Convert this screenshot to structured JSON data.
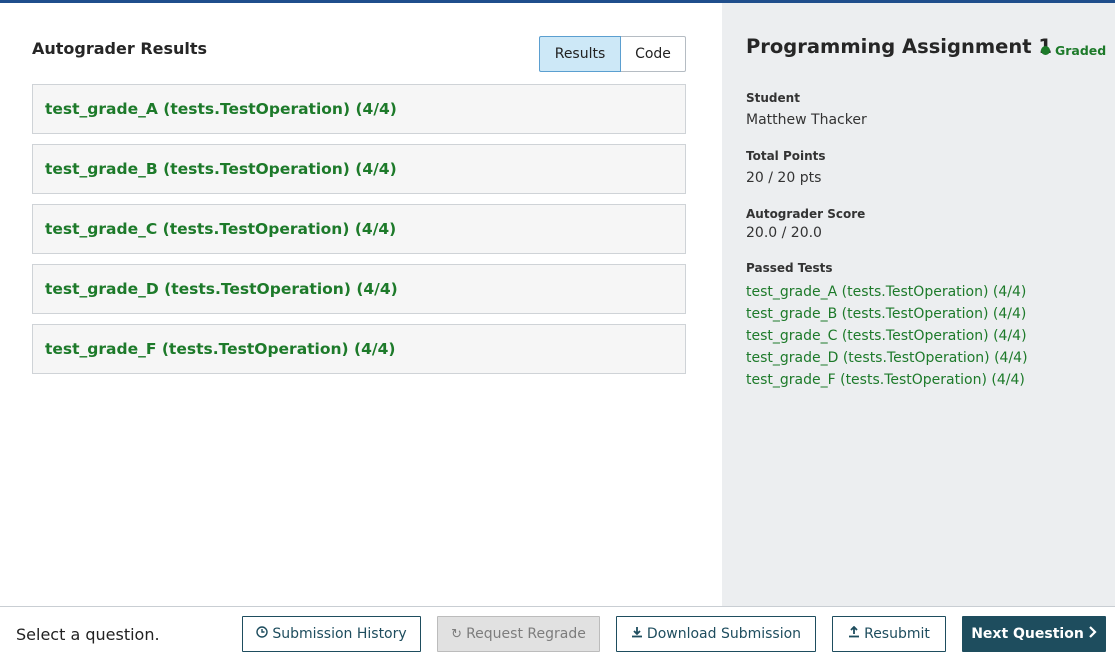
{
  "main": {
    "title": "Autograder Results",
    "tabs": [
      {
        "label": "Results",
        "active": true
      },
      {
        "label": "Code",
        "active": false
      }
    ],
    "tests": [
      "test_grade_A (tests.TestOperation) (4/4)",
      "test_grade_B (tests.TestOperation) (4/4)",
      "test_grade_C (tests.TestOperation) (4/4)",
      "test_grade_D (tests.TestOperation) (4/4)",
      "test_grade_F (tests.TestOperation) (4/4)"
    ]
  },
  "panel": {
    "title": "Programming Assignment 1",
    "status": "Graded",
    "status_color": "#1d7a2a",
    "student_label": "Student",
    "student_name": "Matthew Thacker",
    "total_points_label": "Total Points",
    "total_points": "20 / 20 pts",
    "autograder_label": "Autograder Score",
    "autograder_score": "20.0 / 20.0",
    "passed_label": "Passed Tests",
    "passed_tests": [
      "test_grade_A (tests.TestOperation) (4/4)",
      "test_grade_B (tests.TestOperation) (4/4)",
      "test_grade_C (tests.TestOperation) (4/4)",
      "test_grade_D (tests.TestOperation) (4/4)",
      "test_grade_F (tests.TestOperation) (4/4)"
    ]
  },
  "footer": {
    "prompt": "Select a question.",
    "submission_history": "Submission History",
    "submission_history_icon": "clock-icon",
    "request_regrade": "Request Regrade",
    "request_regrade_icon": "refresh-icon",
    "download_submission": "Download Submission",
    "download_icon": "download-icon",
    "resubmit": "Resubmit",
    "resubmit_icon": "upload-icon",
    "next_question": "Next Question",
    "next_icon": "chevron-right-icon"
  },
  "colors": {
    "accent": "#1e4d5e",
    "success": "#1d7a2a",
    "top_border": "#1f4e8c",
    "panel_bg": "#eceef0"
  }
}
